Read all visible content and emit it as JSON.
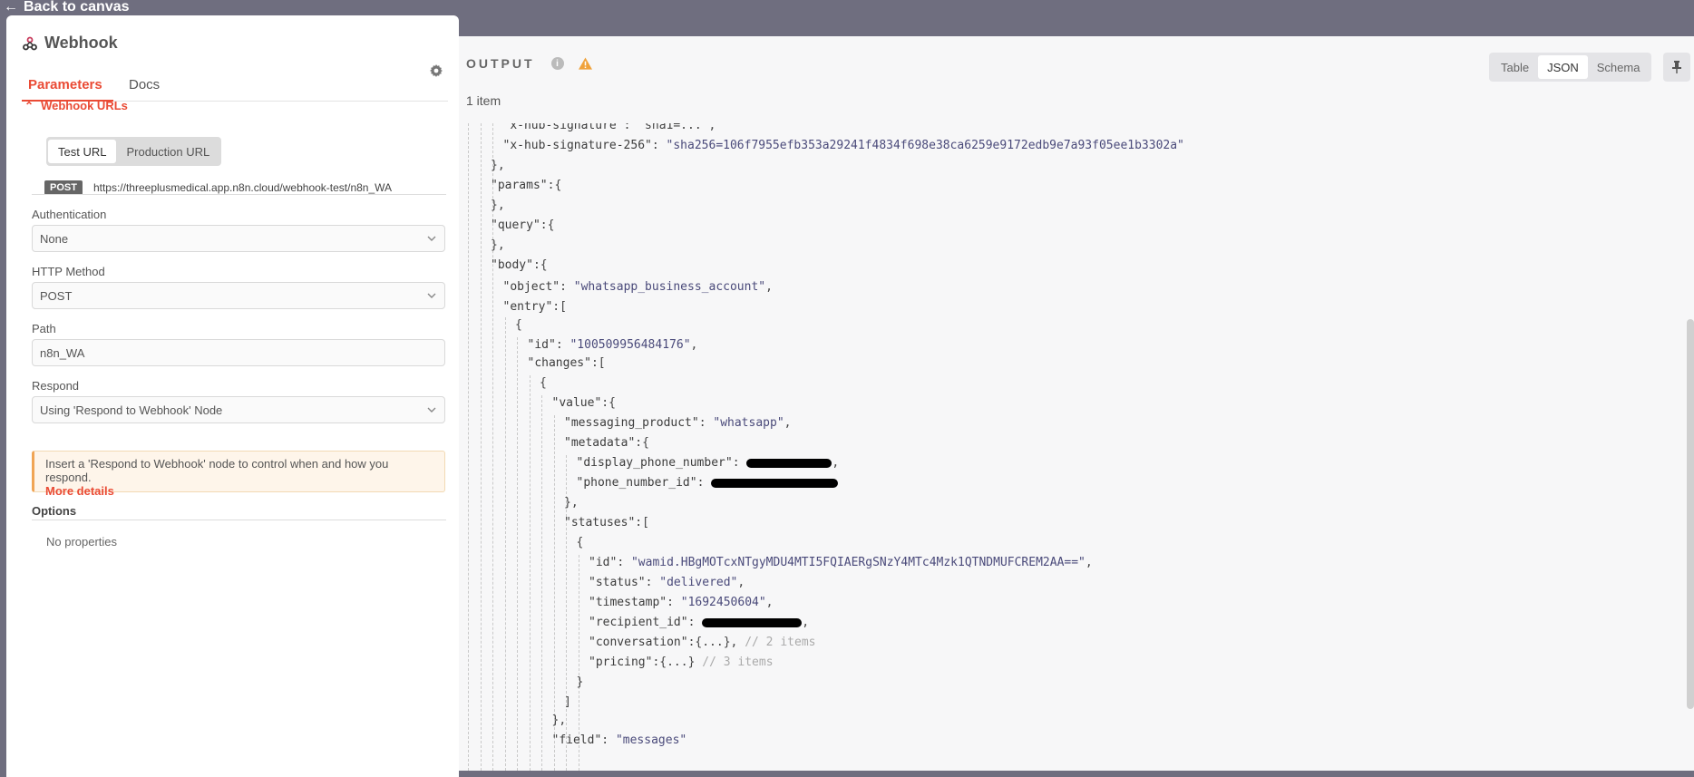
{
  "nav": {
    "back_label": "Back to canvas"
  },
  "node": {
    "title": "Webhook",
    "tabs": [
      {
        "label": "Parameters"
      },
      {
        "label": "Docs"
      }
    ]
  },
  "webhook_urls": {
    "toggle_label": "Webhook URLs",
    "buttons": [
      {
        "label": "Test URL"
      },
      {
        "label": "Production URL"
      }
    ],
    "method_badge": "POST",
    "url": "https://threeplusmedical.app.n8n.cloud/webhook-test/n8n_WA"
  },
  "fields": {
    "authentication": {
      "label": "Authentication",
      "value": "None"
    },
    "http_method": {
      "label": "HTTP Method",
      "value": "POST"
    },
    "path": {
      "label": "Path",
      "value": "n8n_WA"
    },
    "respond": {
      "label": "Respond",
      "value": "Using 'Respond to Webhook' Node"
    }
  },
  "notice": {
    "text": "Insert a 'Respond to Webhook' node to control when and how you respond.",
    "link": "More details"
  },
  "options": {
    "label": "Options",
    "empty_text": "No properties"
  },
  "output": {
    "title": "OUTPUT",
    "view_buttons": [
      {
        "label": "Table"
      },
      {
        "label": "JSON"
      },
      {
        "label": "Schema"
      }
    ],
    "item_count": "1 item"
  },
  "json_lines": {
    "l0": {
      "k": "\"x-hub-signature\"",
      "rest": ": \"sha1=...\","
    },
    "l1": {
      "k": "\"x-hub-signature-256\"",
      "s": "\"sha256=106f7955efb353a29241f4834f698e38ca6259e9172edb9e7a93f05ee1b3302a\""
    },
    "l2": {
      "t": "},"
    },
    "l3": {
      "k": "\"params\"",
      "t": ":{"
    },
    "l4": {
      "t": "},"
    },
    "l5": {
      "k": "\"query\"",
      "t": ":{"
    },
    "l6": {
      "t": "},"
    },
    "l7": {
      "k": "\"body\"",
      "t": ":{"
    },
    "l8": {
      "k": "\"object\"",
      "s": "\"whatsapp_business_account\"",
      "t": ","
    },
    "l9": {
      "k": "\"entry\"",
      "t": ":["
    },
    "l10": {
      "t": "{"
    },
    "l11": {
      "k": "\"id\"",
      "s": "\"100509956484176\"",
      "t": ","
    },
    "l12": {
      "k": "\"changes\"",
      "t": ":["
    },
    "l13": {
      "t": "{"
    },
    "l14": {
      "k": "\"value\"",
      "t": ":{"
    },
    "l15": {
      "k": "\"messaging_product\"",
      "s": "\"whatsapp\"",
      "t": ","
    },
    "l16": {
      "k": "\"metadata\"",
      "t": ":{"
    },
    "l17": {
      "k": "\"display_phone_number\"",
      "t": ","
    },
    "l18": {
      "k": "\"phone_number_id\""
    },
    "l19": {
      "t": "},"
    },
    "l20": {
      "k": "\"statuses\"",
      "t": ":["
    },
    "l21": {
      "t": "{"
    },
    "l22": {
      "k": "\"id\"",
      "s": "\"wamid.HBgMOTcxNTgyMDU4MTI5FQIAERgSNzY4MTc4Mzk1QTNDMUFCREM2AA==\"",
      "t": ","
    },
    "l23": {
      "k": "\"status\"",
      "s": "\"delivered\"",
      "t": ","
    },
    "l24": {
      "k": "\"timestamp\"",
      "s": "\"1692450604\"",
      "t": ","
    },
    "l25": {
      "k": "\"recipient_id\"",
      "t": ","
    },
    "l26": {
      "k": "\"conversation\"",
      "t": ":{...},",
      "c": "// 2 items"
    },
    "l27": {
      "k": "\"pricing\"",
      "t": ":{...}",
      "c": "// 3 items"
    },
    "l28": {
      "t": "}"
    },
    "l29": {
      "t": "]"
    },
    "l30": {
      "t": "},"
    },
    "l31": {
      "k": "\"field\"",
      "s": "\"messages\""
    }
  }
}
